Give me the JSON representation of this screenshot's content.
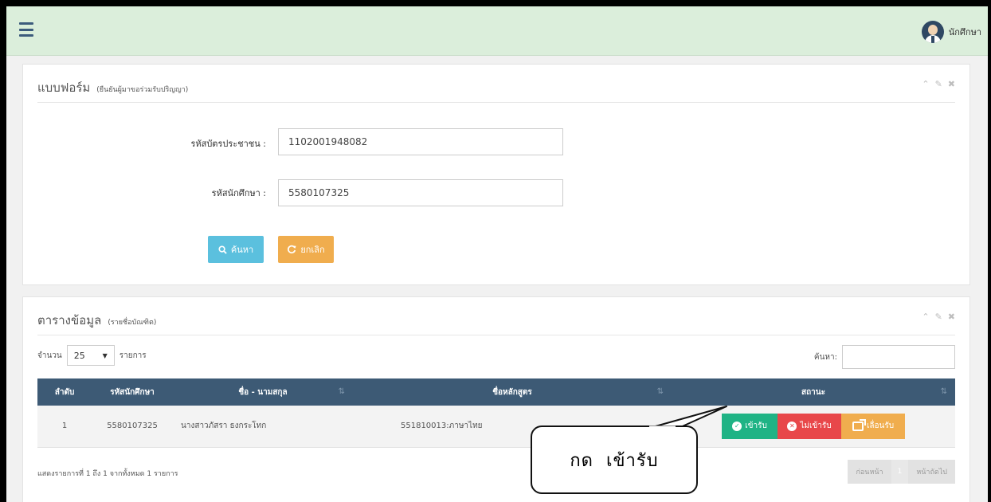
{
  "header": {
    "user_name": "นักศึกษา"
  },
  "form_panel": {
    "title": "แบบฟอร์ม",
    "subtitle": "(ยืนยันผู้มาขอร่วมรับปริญญา)",
    "id_card_label": "รหัสบัตรประชาชน :",
    "id_card_value": "1102001948082",
    "student_id_label": "รหัสนักศึกษา :",
    "student_id_value": "5580107325",
    "search_label": "ค้นหา",
    "cancel_label": "ยกเลิก"
  },
  "table_panel": {
    "title": "ตารางข้อมูล",
    "subtitle": "(รายชื่อบัณฑิต)",
    "length_prefix": "จำนวน",
    "length_value": "25",
    "length_suffix": "รายการ",
    "filter_label": "ค้นหา:",
    "columns": [
      "ลำดับ",
      "รหัสนักศึกษา",
      "ชื่อ - นามสกุล",
      "ชื่อหลักสูตร",
      "สถานะ"
    ],
    "rows": [
      {
        "no": "1",
        "student_id": "5580107325",
        "name": "นางสาวภัสรา ธงกระโทก",
        "program": "551810013:ภาษาไทย"
      }
    ],
    "accept_label": "เข้ารับ",
    "reject_label": "ไม่เข้ารับ",
    "postpone_label": "เลื่อนรับ",
    "info": "แสดงรายการที่ 1 ถึง 1 จากทั้งหมด 1 รายการ",
    "prev_label": "ก่อนหน้า",
    "page_current": "1",
    "next_label": "หน้าถัดไป"
  },
  "callout": {
    "text": "กด  เข้ารับ"
  },
  "colors": {
    "header_bg": "#dbeedb",
    "table_head": "#3d5a75",
    "accept": "#1fb385",
    "reject": "#e8474a",
    "postpone": "#f0ad4e",
    "search": "#5bc0de"
  },
  "icons": {
    "menu": "hamburger-icon",
    "collapse": "chevron-up-icon",
    "settings": "wrench-icon",
    "close": "close-icon",
    "search": "search-icon",
    "refresh": "refresh-icon",
    "accept": "check-circle-icon",
    "reject": "x-circle-icon",
    "postpone": "share-icon"
  }
}
